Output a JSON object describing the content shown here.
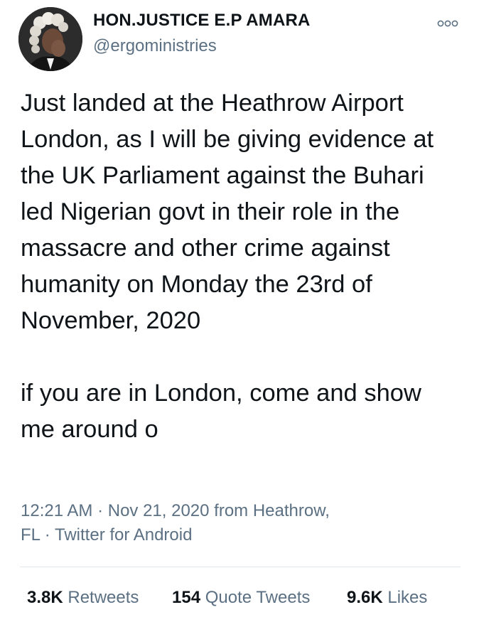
{
  "author": {
    "display_name": "HON.JUSTICE E.P AMARA",
    "handle": "@ergoministries",
    "avatar_icon": "profile-photo-barrister-wig"
  },
  "more_icon": "more-options-icon",
  "tweet": {
    "paragraphs": [
      "Just landed at the Heathrow Airport London, as I will be giving evidence at the UK Parliament against the Buhari led Nigerian govt in their role in the massacre and other crime against humanity on Monday the 23rd of November, 2020",
      "if you are in London, come and show me around o"
    ]
  },
  "meta": {
    "line1": "12:21 AM · Nov 21, 2020 from Heathrow,",
    "line2": "FL · Twitter for Android"
  },
  "stats": {
    "retweets": {
      "count": "3.8K",
      "label": "Retweets"
    },
    "quote_tweets": {
      "count": "154",
      "label": "Quote Tweets"
    },
    "likes": {
      "count": "9.6K",
      "label": "Likes"
    }
  },
  "colors": {
    "text": "#0f1419",
    "secondary": "#5b7083",
    "divider": "#e1e8ed"
  }
}
